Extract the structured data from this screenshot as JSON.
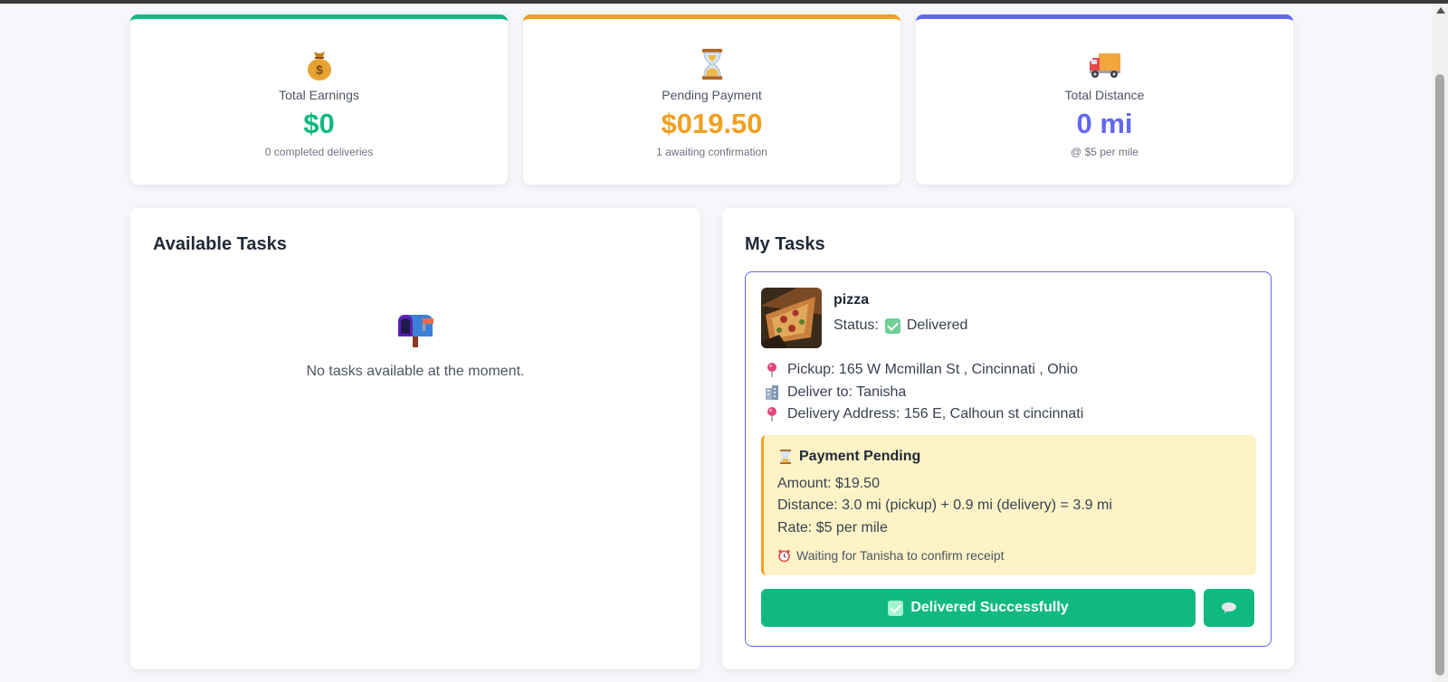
{
  "stats": {
    "earnings": {
      "icon": "money-bag-icon",
      "label": "Total Earnings",
      "value": "$0",
      "sub": "0 completed deliveries",
      "color": "#10b981"
    },
    "pending": {
      "icon": "hourglass-icon",
      "label": "Pending Payment",
      "value": "$019.50",
      "sub": "1 awaiting confirmation",
      "color": "#f0a020"
    },
    "distance": {
      "icon": "delivery-truck-icon",
      "label": "Total Distance",
      "value": "0 mi",
      "sub": "@ $5 per mile",
      "color": "#6366f1"
    }
  },
  "available": {
    "title": "Available Tasks",
    "empty_icon": "mailbox-icon",
    "empty_text": "No tasks available at the moment."
  },
  "my_tasks": {
    "title": "My Tasks",
    "task": {
      "name": "pizza",
      "status_label": "Status:",
      "status_value": "Delivered",
      "pickup": "Pickup: 165 W Mcmillan St , Cincinnati , Ohio",
      "deliver_to": "Deliver to: Tanisha",
      "delivery_address": "Delivery Address: 156 E, Calhoun st cincinnati",
      "payment": {
        "title": "Payment Pending",
        "amount": "Amount: $19.50",
        "distance": "Distance: 3.0 mi (pickup) + 0.9 mi (delivery) = 3.9 mi",
        "rate": "Rate: $5 per mile",
        "waiting": "Waiting for Tanisha to confirm receipt"
      },
      "deliver_button": "Delivered Successfully",
      "chat_button_icon": "chat-bubble-icon"
    }
  },
  "colors": {
    "accent_green": "#10b981",
    "accent_orange": "#f0a020",
    "accent_purple": "#6366f1",
    "payment_bg": "#fef3c7"
  }
}
